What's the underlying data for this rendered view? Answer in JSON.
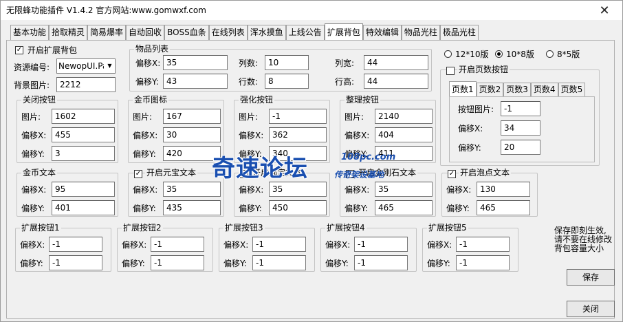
{
  "window": {
    "title": "无限蜂功能插件 V1.4.2  官方网站:www.gomwxf.com",
    "close_glyph": "✕"
  },
  "tabs": [
    "基本功能",
    "拾取精灵",
    "简易爆率",
    "自动回收",
    "BOSS血条",
    "在线列表",
    "浑水摸鱼",
    "上线公告",
    "扩展背包",
    "特效编辑",
    "物品光柱",
    "极品光柱"
  ],
  "main": {
    "enable_label": "开启扩展背包",
    "enable_checked": "✓",
    "res_label": "资源编号:",
    "res_value": "NewopUI.Pak",
    "bg_label": "背景图片:",
    "bg_value": "2212"
  },
  "item_list": {
    "title": "物品列表",
    "offset_x_label": "偏移X:",
    "offset_x": "35",
    "offset_y_label": "偏移Y:",
    "offset_y": "43",
    "cols_label": "列数:",
    "cols": "10",
    "rows_label": "行数:",
    "rows": "8",
    "col_w_label": "列宽:",
    "col_w": "44",
    "row_h_label": "行高:",
    "row_h": "44"
  },
  "versions": {
    "v1": "12*10版",
    "v2": "10*8版",
    "v3": "8*5版"
  },
  "page_btn": {
    "enable_label": "开启页数按钮",
    "pages": [
      "页数1",
      "页数2",
      "页数3",
      "页数4",
      "页数5"
    ],
    "img_label": "按钮图片:",
    "img": "-1",
    "x_label": "偏移X:",
    "x": "34",
    "y_label": "偏移Y:",
    "y": "20"
  },
  "close_btn": {
    "title": "关闭按钮",
    "img_label": "图片:",
    "img": "1602",
    "x_label": "偏移X:",
    "x": "455",
    "y_label": "偏移Y:",
    "y": "3"
  },
  "gold_icon": {
    "title": "金币图标",
    "img_label": "图片:",
    "img": "167",
    "x_label": "偏移X:",
    "x": "30",
    "y_label": "偏移Y:",
    "y": "420"
  },
  "enhance_btn": {
    "title": "强化按钮",
    "img_label": "图片:",
    "img": "-1",
    "x_label": "偏移X:",
    "x": "362",
    "y_label": "偏移Y:",
    "y": "340"
  },
  "sort_btn": {
    "title": "整理按钮",
    "img_label": "图片:",
    "img": "2140",
    "x_label": "偏移X:",
    "x": "404",
    "y_label": "偏移Y:",
    "y": "411"
  },
  "gold_text": {
    "title": "金币文本",
    "x_label": "偏移X:",
    "x": "95",
    "y_label": "偏移Y:",
    "y": "401"
  },
  "yuanbao_text": {
    "title": "开启元宝文本",
    "x_label": "偏移X:",
    "x": "35",
    "y_label": "偏移Y:",
    "y": "435"
  },
  "text3": {
    "title": "开启绑定文本",
    "x_label": "偏移X:",
    "x": "35",
    "y_label": "偏移Y:",
    "y": "450"
  },
  "text4": {
    "title": "开启金刚石文本",
    "x_label": "偏移X:",
    "x": "35",
    "y_label": "偏移Y:",
    "y": "465"
  },
  "bubble_text": {
    "title": "开启泡点文本",
    "x_label": "偏移X:",
    "x": "130",
    "y_label": "偏移Y:",
    "y": "465"
  },
  "ext_buttons": [
    {
      "title": "扩展按钮1",
      "x_label": "偏移X:",
      "x": "-1",
      "y_label": "偏移Y:",
      "y": "-1"
    },
    {
      "title": "扩展按钮2",
      "x_label": "偏移X:",
      "x": "-1",
      "y_label": "偏移Y:",
      "y": "-1"
    },
    {
      "title": "扩展按钮3",
      "x_label": "偏移X:",
      "x": "-1",
      "y_label": "偏移Y:",
      "y": "-1"
    },
    {
      "title": "扩展按钮4",
      "x_label": "偏移X:",
      "x": "-1",
      "y_label": "偏移Y:",
      "y": "-1"
    },
    {
      "title": "扩展按钮5",
      "x_label": "偏移X:",
      "x": "-1",
      "y_label": "偏移Y:",
      "y": "-1"
    }
  ],
  "note": "保存即刻生效,\n请不要在线修改\n背包容量大小",
  "buttons": {
    "save": "保存",
    "close": "关闭"
  },
  "watermark": {
    "main": "奇速论坛",
    "site": "108pc.com",
    "sub": "传奇架设基地"
  }
}
